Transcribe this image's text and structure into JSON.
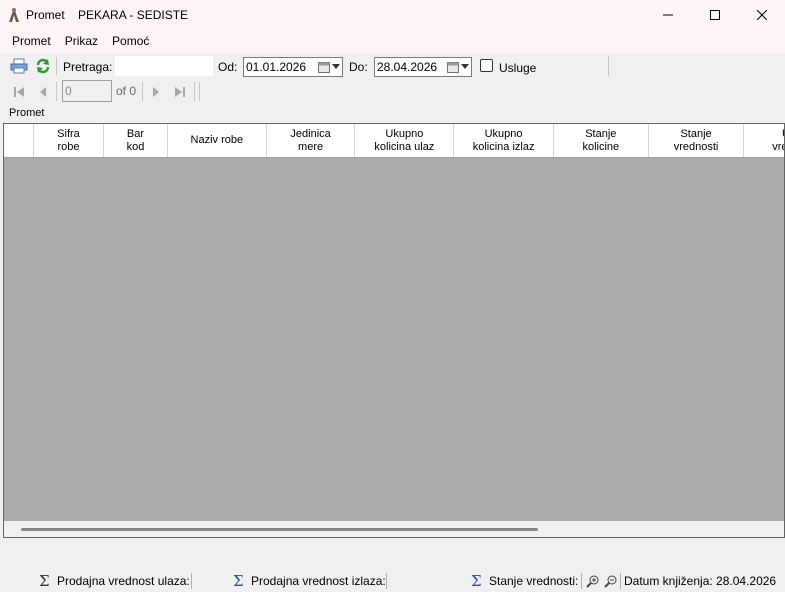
{
  "window": {
    "title": "Promet    PEKARA - SEDISTE"
  },
  "menu": {
    "items": [
      "Promet",
      "Prikaz",
      "Pomoć"
    ]
  },
  "toolbar": {
    "search_label": "Pretraga:",
    "search_value": "",
    "from_label": "Od:",
    "from_date": "01.01.2026",
    "to_label": "Do:",
    "to_date": "28.04.2026",
    "services_label": "Usluge",
    "services_checked": false
  },
  "navigator": {
    "position": "0",
    "of_label": "of 0"
  },
  "group": {
    "label": "Promet"
  },
  "grid": {
    "columns": [
      "",
      "Sifra\nrobe",
      "Bar\nkod",
      "Naziv robe",
      "Jedinica\nmere",
      "Ukupno\nkolicina ulaz",
      "Ukupno\nkolicina izlaz",
      "Stanje\nkolicine",
      "Stanje\nvrednosti",
      "U\nvredn"
    ],
    "rows": []
  },
  "status": {
    "sale_in_label": "Prodajna vrednost ulaza:",
    "sale_out_label": "Prodajna vrednost izlaza:",
    "stock_value_label": "Stanje vrednosti:",
    "booking_date_label": "Datum knjiženja: 28.04.2026"
  },
  "colors": {
    "titlebar_bg": "#fdf5f5",
    "grid_bg": "#ababab",
    "sigma": "#1f4fb4"
  }
}
